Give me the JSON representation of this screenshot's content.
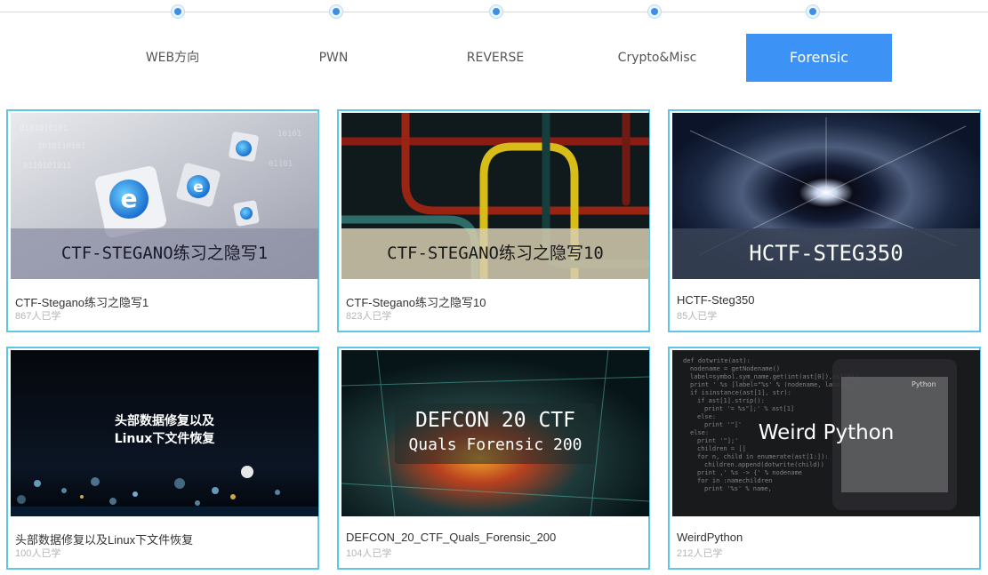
{
  "tabs": [
    {
      "label": "WEB方向",
      "active": false
    },
    {
      "label": "PWN",
      "active": false
    },
    {
      "label": "REVERSE",
      "active": false
    },
    {
      "label": "Crypto&Misc",
      "active": false
    },
    {
      "label": "Forensic",
      "active": true
    }
  ],
  "colors": {
    "accent": "#3d93f5",
    "card_border": "#5fc6ea",
    "timeline_dot": "#3d8fe6"
  },
  "courses": [
    {
      "title": "CTF-Stegano练习之隐写1",
      "learners": "867人已学",
      "thumb_caption": "CTF-STEGANO练习之隐写1"
    },
    {
      "title": "CTF-Stegano练习之隐写10",
      "learners": "823人已学",
      "thumb_caption": "CTF-STEGANO练习之隐写10"
    },
    {
      "title": "HCTF-Steg350",
      "learners": "85人已学",
      "thumb_caption": "HCTF-STEG350"
    },
    {
      "title": "头部数据修复以及Linux下文件恢复",
      "learners": "100人已学",
      "thumb_caption_1": "头部数据修复以及",
      "thumb_caption_2": "Linux下文件恢复"
    },
    {
      "title": "DEFCON_20_CTF_Quals_Forensic_200",
      "learners": "104人已学",
      "thumb_caption_1": "DEFCON 20 CTF",
      "thumb_caption_2": "Quals Forensic 200"
    },
    {
      "title": "WeirdPython",
      "learners": "212人已学",
      "thumb_caption": "Weird Python",
      "thumb_caption_2": "Python"
    }
  ]
}
